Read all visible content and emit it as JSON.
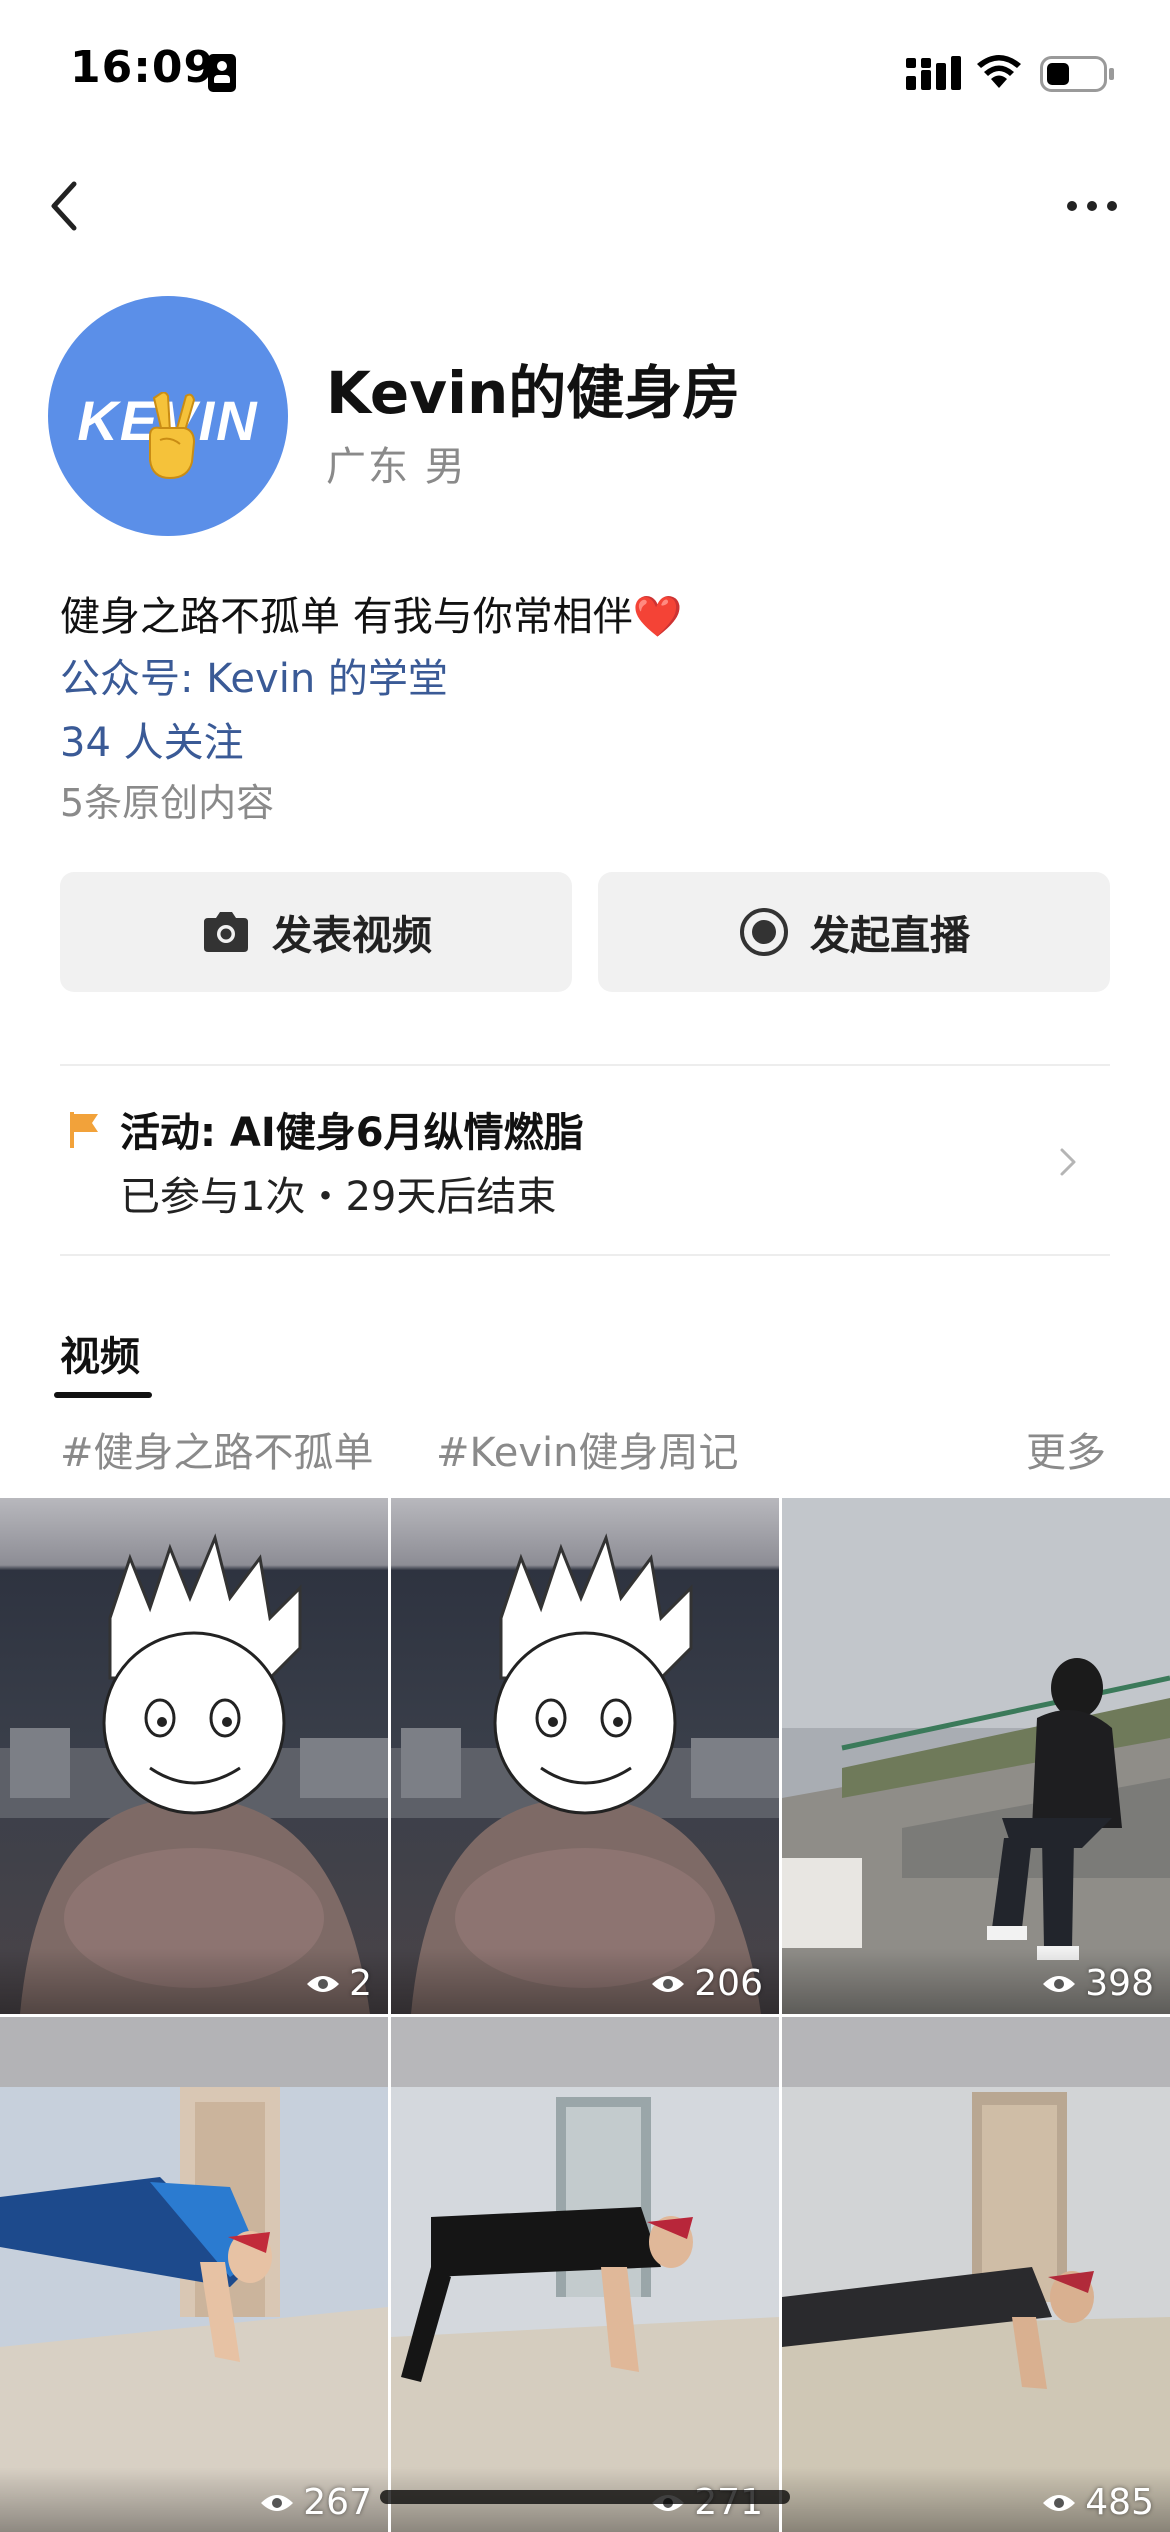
{
  "status_bar": {
    "time": "16:09"
  },
  "profile": {
    "avatar_text": "KEVIN",
    "name": "Kevin的健身房",
    "location_gender": "广东 男",
    "bio": "健身之路不孤单 有我与你常相伴",
    "bio_emoji": "❤️",
    "official_account": "公众号: Kevin 的学堂",
    "followers": "34 人关注",
    "original_count": "5条原创内容"
  },
  "actions": {
    "post_video": "发表视频",
    "start_live": "发起直播"
  },
  "activity": {
    "title": "活动: AI健身6月纵情燃脂",
    "subtitle": "已参与1次・29天后结束"
  },
  "tabs": {
    "video": "视频",
    "topics": [
      "#健身之路不孤单",
      "#Kevin健身周记"
    ],
    "more": "更多"
  },
  "videos": [
    {
      "views": "2",
      "scene": "cartoon-face-night"
    },
    {
      "views": "206",
      "scene": "cartoon-face-night"
    },
    {
      "views": "398",
      "scene": "rooftop-sitting"
    },
    {
      "views": "267",
      "scene": "pushup-blue-shirt"
    },
    {
      "views": "271",
      "scene": "pushup-black-shirt"
    },
    {
      "views": "485",
      "scene": "pushup-dark-outfit"
    }
  ],
  "colors": {
    "link": "#3a5a96",
    "muted": "#8a8a8a",
    "avatar_bg": "#5b8fe8",
    "flag": "#f2a23a",
    "button_bg": "#f1f1f1"
  }
}
